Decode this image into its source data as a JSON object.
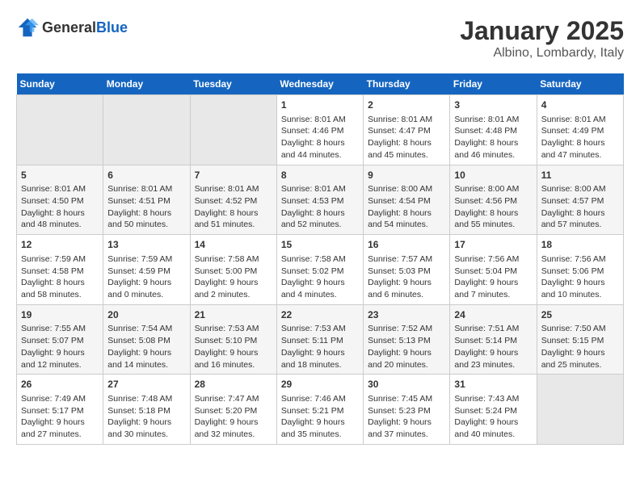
{
  "header": {
    "logo_general": "General",
    "logo_blue": "Blue",
    "title": "January 2025",
    "subtitle": "Albino, Lombardy, Italy"
  },
  "weekdays": [
    "Sunday",
    "Monday",
    "Tuesday",
    "Wednesday",
    "Thursday",
    "Friday",
    "Saturday"
  ],
  "weeks": [
    [
      {
        "day": "",
        "info": ""
      },
      {
        "day": "",
        "info": ""
      },
      {
        "day": "",
        "info": ""
      },
      {
        "day": "1",
        "info": "Sunrise: 8:01 AM\nSunset: 4:46 PM\nDaylight: 8 hours and 44 minutes."
      },
      {
        "day": "2",
        "info": "Sunrise: 8:01 AM\nSunset: 4:47 PM\nDaylight: 8 hours and 45 minutes."
      },
      {
        "day": "3",
        "info": "Sunrise: 8:01 AM\nSunset: 4:48 PM\nDaylight: 8 hours and 46 minutes."
      },
      {
        "day": "4",
        "info": "Sunrise: 8:01 AM\nSunset: 4:49 PM\nDaylight: 8 hours and 47 minutes."
      }
    ],
    [
      {
        "day": "5",
        "info": "Sunrise: 8:01 AM\nSunset: 4:50 PM\nDaylight: 8 hours and 48 minutes."
      },
      {
        "day": "6",
        "info": "Sunrise: 8:01 AM\nSunset: 4:51 PM\nDaylight: 8 hours and 50 minutes."
      },
      {
        "day": "7",
        "info": "Sunrise: 8:01 AM\nSunset: 4:52 PM\nDaylight: 8 hours and 51 minutes."
      },
      {
        "day": "8",
        "info": "Sunrise: 8:01 AM\nSunset: 4:53 PM\nDaylight: 8 hours and 52 minutes."
      },
      {
        "day": "9",
        "info": "Sunrise: 8:00 AM\nSunset: 4:54 PM\nDaylight: 8 hours and 54 minutes."
      },
      {
        "day": "10",
        "info": "Sunrise: 8:00 AM\nSunset: 4:56 PM\nDaylight: 8 hours and 55 minutes."
      },
      {
        "day": "11",
        "info": "Sunrise: 8:00 AM\nSunset: 4:57 PM\nDaylight: 8 hours and 57 minutes."
      }
    ],
    [
      {
        "day": "12",
        "info": "Sunrise: 7:59 AM\nSunset: 4:58 PM\nDaylight: 8 hours and 58 minutes."
      },
      {
        "day": "13",
        "info": "Sunrise: 7:59 AM\nSunset: 4:59 PM\nDaylight: 9 hours and 0 minutes."
      },
      {
        "day": "14",
        "info": "Sunrise: 7:58 AM\nSunset: 5:00 PM\nDaylight: 9 hours and 2 minutes."
      },
      {
        "day": "15",
        "info": "Sunrise: 7:58 AM\nSunset: 5:02 PM\nDaylight: 9 hours and 4 minutes."
      },
      {
        "day": "16",
        "info": "Sunrise: 7:57 AM\nSunset: 5:03 PM\nDaylight: 9 hours and 6 minutes."
      },
      {
        "day": "17",
        "info": "Sunrise: 7:56 AM\nSunset: 5:04 PM\nDaylight: 9 hours and 7 minutes."
      },
      {
        "day": "18",
        "info": "Sunrise: 7:56 AM\nSunset: 5:06 PM\nDaylight: 9 hours and 10 minutes."
      }
    ],
    [
      {
        "day": "19",
        "info": "Sunrise: 7:55 AM\nSunset: 5:07 PM\nDaylight: 9 hours and 12 minutes."
      },
      {
        "day": "20",
        "info": "Sunrise: 7:54 AM\nSunset: 5:08 PM\nDaylight: 9 hours and 14 minutes."
      },
      {
        "day": "21",
        "info": "Sunrise: 7:53 AM\nSunset: 5:10 PM\nDaylight: 9 hours and 16 minutes."
      },
      {
        "day": "22",
        "info": "Sunrise: 7:53 AM\nSunset: 5:11 PM\nDaylight: 9 hours and 18 minutes."
      },
      {
        "day": "23",
        "info": "Sunrise: 7:52 AM\nSunset: 5:13 PM\nDaylight: 9 hours and 20 minutes."
      },
      {
        "day": "24",
        "info": "Sunrise: 7:51 AM\nSunset: 5:14 PM\nDaylight: 9 hours and 23 minutes."
      },
      {
        "day": "25",
        "info": "Sunrise: 7:50 AM\nSunset: 5:15 PM\nDaylight: 9 hours and 25 minutes."
      }
    ],
    [
      {
        "day": "26",
        "info": "Sunrise: 7:49 AM\nSunset: 5:17 PM\nDaylight: 9 hours and 27 minutes."
      },
      {
        "day": "27",
        "info": "Sunrise: 7:48 AM\nSunset: 5:18 PM\nDaylight: 9 hours and 30 minutes."
      },
      {
        "day": "28",
        "info": "Sunrise: 7:47 AM\nSunset: 5:20 PM\nDaylight: 9 hours and 32 minutes."
      },
      {
        "day": "29",
        "info": "Sunrise: 7:46 AM\nSunset: 5:21 PM\nDaylight: 9 hours and 35 minutes."
      },
      {
        "day": "30",
        "info": "Sunrise: 7:45 AM\nSunset: 5:23 PM\nDaylight: 9 hours and 37 minutes."
      },
      {
        "day": "31",
        "info": "Sunrise: 7:43 AM\nSunset: 5:24 PM\nDaylight: 9 hours and 40 minutes."
      },
      {
        "day": "",
        "info": ""
      }
    ]
  ]
}
